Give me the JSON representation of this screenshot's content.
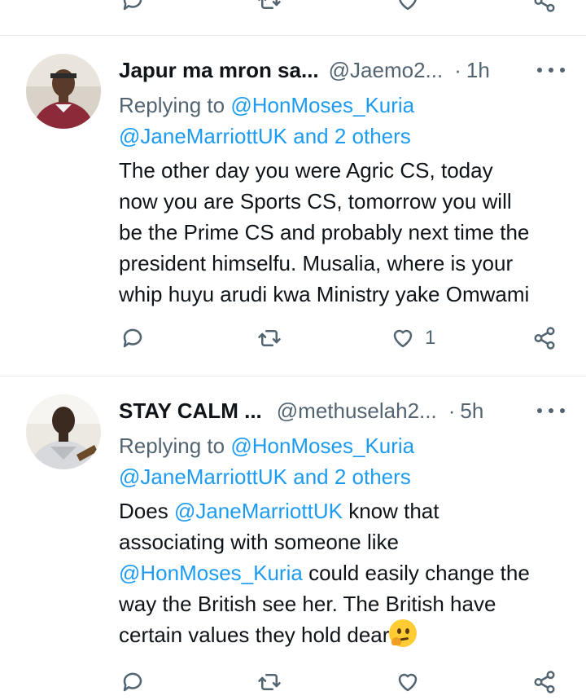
{
  "tweets": [
    {
      "name": "Japur ma mron sa...",
      "handle": "@Jaemo2...",
      "dot": "·",
      "time": "1h",
      "replying_prefix": "Replying to",
      "replying_mention1": "@HonMoses_Kuria",
      "replying_mention2": "@JaneMarriottUK",
      "replying_others": "and 2 others",
      "body_lines": [
        "The other day you were Agric CS, today",
        "now you are Sports CS, tomorrow you will",
        "be the Prime CS and probably next time the",
        "president himselfu. Musalia, where is your",
        "whip huyu arudi kwa Ministry yake Omwami"
      ],
      "like_count": "1"
    },
    {
      "name": "STAY CALM ...",
      "handle": "@methuselah2...",
      "dot": "·",
      "time": "5h",
      "replying_prefix": "Replying to",
      "replying_mention1": "@HonMoses_Kuria",
      "replying_mention2": "@JaneMarriottUK",
      "replying_others": "and 2 others",
      "body": {
        "l1_a": "Does",
        "l1_mention": "@JaneMarriottUK",
        "l1_b": "know that",
        "l2": "associating with someone like",
        "l3_mention": "@HonMoses_Kuria",
        "l3_b": "could easily change the",
        "l4": "way the British see her. The British have",
        "l5": "certain values they hold dear"
      },
      "emoji": "thinking-face"
    }
  ],
  "icons": {
    "reply": "reply-icon",
    "retweet": "retweet-icon",
    "like": "heart-icon",
    "share": "share-icon",
    "more": "more-icon"
  },
  "colors": {
    "accent": "#1d9bf0",
    "secondary_text": "#536471",
    "primary_text": "#0f1419",
    "divider": "#e6ecf0"
  }
}
